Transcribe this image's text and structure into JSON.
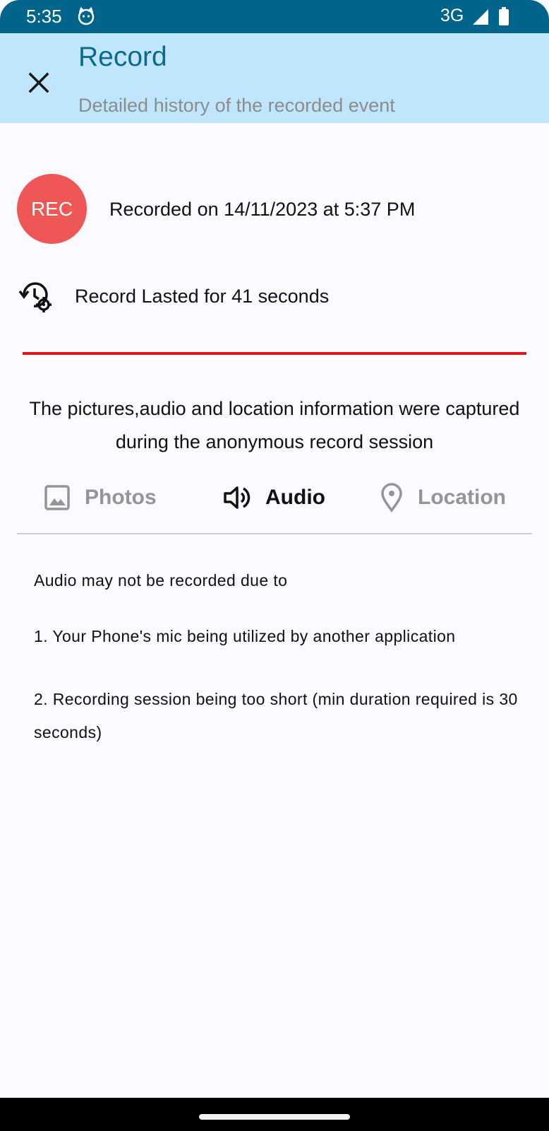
{
  "status_bar": {
    "time": "5:35",
    "network": "3G"
  },
  "app_bar": {
    "title": "Record",
    "subtitle": "Detailed history of the recorded event",
    "close_icon": "close-icon"
  },
  "record": {
    "badge": "REC",
    "recorded_on": "Recorded on 14/11/2023 at 5:37 PM",
    "lasted": "Record Lasted for 41 seconds"
  },
  "info_text": "The pictures,audio and location information were captured during the anonymous record session",
  "tabs": [
    {
      "label": "Photos",
      "icon": "image-icon",
      "active": false
    },
    {
      "label": "Audio",
      "icon": "speaker-icon",
      "active": true
    },
    {
      "label": "Location",
      "icon": "location-pin-icon",
      "active": false
    }
  ],
  "audio_notes": {
    "heading": "Audio may not be recorded due to",
    "item1": "1. Your Phone's mic being utilized by another application",
    "item2": "2. Recording session being too short (min duration required is 30 seconds)"
  },
  "colors": {
    "status_bar": "#00648b",
    "app_bar": "#bfe6fc",
    "title": "#0b6a8e",
    "rec_badge": "#ef5656",
    "divider_red": "#e0161c"
  }
}
